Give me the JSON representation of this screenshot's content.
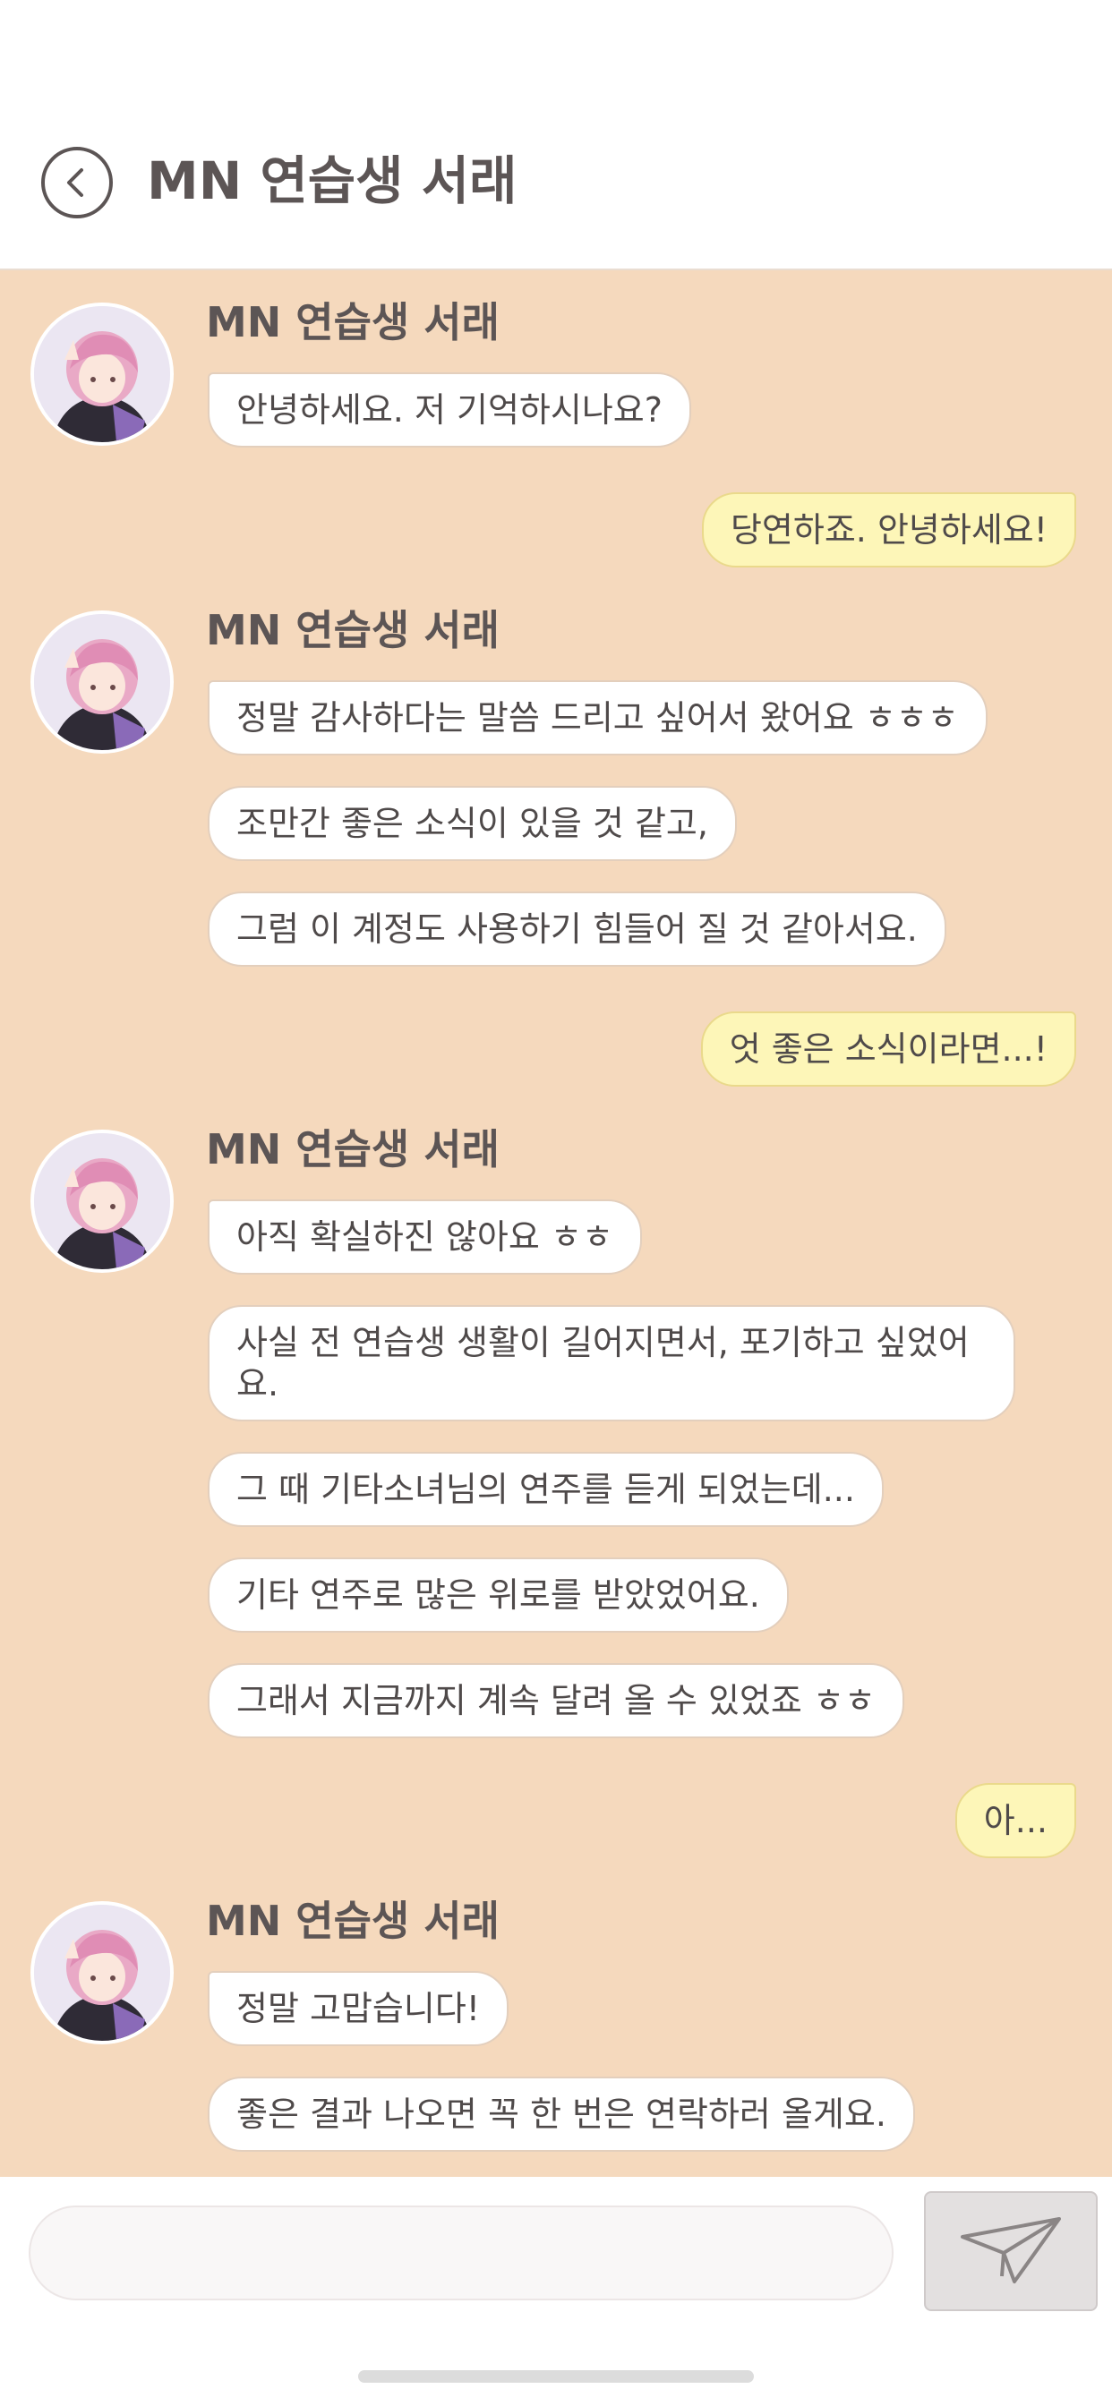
{
  "header": {
    "title": "MN 연습생 서래",
    "back_icon": "chevron-left-icon"
  },
  "chat": {
    "contact_name": "MN 연습생 서래",
    "messages": [
      {
        "from": "them",
        "text": "안녕하세요. 저 기억하시나요?"
      },
      {
        "from": "me",
        "text": "당연하죠. 안녕하세요!"
      },
      {
        "from": "them",
        "text": "정말 감사하다는 말씀 드리고 싶어서 왔어요 ㅎㅎㅎ"
      },
      {
        "from": "them",
        "text": "조만간 좋은 소식이 있을 것 같고,"
      },
      {
        "from": "them",
        "text": "그럼 이 계정도 사용하기 힘들어 질 것 같아서요."
      },
      {
        "from": "me",
        "text": "엇 좋은 소식이라면...!"
      },
      {
        "from": "them",
        "text": "아직 확실하진 않아요 ㅎㅎ"
      },
      {
        "from": "them",
        "text": "사실 전 연습생 생활이 길어지면서, 포기하고 싶었어요."
      },
      {
        "from": "them",
        "text": "그 때 기타소녀님의 연주를 듣게 되었는데..."
      },
      {
        "from": "them",
        "text": "기타 연주로 많은 위로를 받았었어요."
      },
      {
        "from": "them",
        "text": "그래서 지금까지 계속 달려 올 수 있었죠 ㅎㅎ"
      },
      {
        "from": "me",
        "text": "아..."
      },
      {
        "from": "them",
        "text": "정말 고맙습니다!"
      },
      {
        "from": "them",
        "text": "좋은 결과 나오면 꼭 한 번은 연락하러 올게요."
      }
    ]
  },
  "composer": {
    "input_value": "",
    "send_icon": "paper-plane-icon"
  },
  "colors": {
    "chat_background": "#f5d9bd",
    "outgoing_bubble": "#fdf6b8",
    "incoming_bubble": "#ffffff",
    "text": "#4f4a4a"
  }
}
